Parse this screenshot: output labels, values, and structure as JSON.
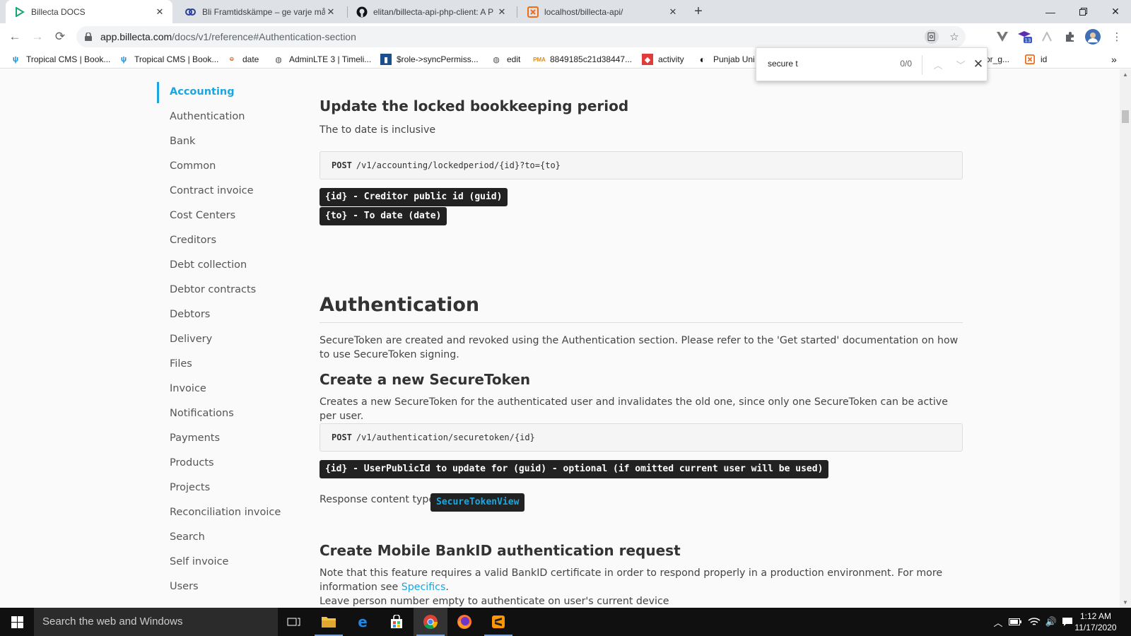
{
  "browser": {
    "tabs": [
      {
        "title": "Billecta DOCS",
        "icon": "billecta-icon"
      },
      {
        "title": "Bli Framtidskämpe – ge varje må",
        "icon": "framtid-icon"
      },
      {
        "title": "elitan/billecta-api-php-client: A P",
        "icon": "github-icon"
      },
      {
        "title": "localhost/billecta-api/",
        "icon": "localhost-icon"
      }
    ],
    "new_tab_label": "+",
    "url_host": "app.billecta.com",
    "url_path": "/docs/v1/reference#Authentication-section",
    "bookmarks": [
      {
        "label": "Tropical CMS | Book...",
        "icon": "palm-icon"
      },
      {
        "label": "Tropical CMS | Book...",
        "icon": "palm-icon"
      },
      {
        "label": "date",
        "icon": "php-icon"
      },
      {
        "label": "AdminLTE 3 | Timeli...",
        "icon": "globe-icon"
      },
      {
        "label": "$role->syncPermiss...",
        "icon": "bookmark-icon"
      },
      {
        "label": "edit",
        "icon": "globe-icon"
      },
      {
        "label": "8849185c21d38447...",
        "icon": "pma-icon"
      },
      {
        "label": "activity",
        "icon": "laravel-icon"
      },
      {
        "label": "Punjab Uni",
        "icon": "contrast-icon"
      },
      {
        "label": "or_g...",
        "icon": "bookmark-icon"
      },
      {
        "label": "id",
        "icon": "localhost-icon"
      }
    ],
    "profile_badge": "13",
    "find": {
      "query": "secure t",
      "count": "0/0"
    }
  },
  "sidebar": {
    "items": [
      {
        "label": "Accounting",
        "active": true
      },
      {
        "label": "Authentication"
      },
      {
        "label": "Bank"
      },
      {
        "label": "Common"
      },
      {
        "label": "Contract invoice"
      },
      {
        "label": "Cost Centers"
      },
      {
        "label": "Creditors"
      },
      {
        "label": "Debt collection"
      },
      {
        "label": "Debtor contracts"
      },
      {
        "label": "Debtors"
      },
      {
        "label": "Delivery"
      },
      {
        "label": "Files"
      },
      {
        "label": "Invoice"
      },
      {
        "label": "Notifications"
      },
      {
        "label": "Payments"
      },
      {
        "label": "Products"
      },
      {
        "label": "Projects"
      },
      {
        "label": "Reconciliation invoice"
      },
      {
        "label": "Search"
      },
      {
        "label": "Self invoice"
      },
      {
        "label": "Users"
      }
    ]
  },
  "content": {
    "locked_period": {
      "title": "Update the locked bookkeeping period",
      "desc": "The to date is inclusive",
      "method": "POST",
      "path": "/v1/accounting/lockedperiod/{id}?to={to}",
      "params": [
        "{id} - Creditor public id (guid)",
        "{to} - To date (date)"
      ]
    },
    "auth_section": {
      "title": "Authentication",
      "desc": "SecureToken are created and revoked using the Authentication section. Please refer to the 'Get started' documentation on how to use SecureToken signing."
    },
    "create_token": {
      "title": "Create a new SecureToken",
      "desc": "Creates a new SecureToken for the authenticated user and invalidates the old one, since only one SecureToken can be active per user.",
      "method": "POST",
      "path": "/v1/authentication/securetoken/{id}",
      "params": [
        "{id} - UserPublicId to update for (guid) - optional (if omitted current user will be used)"
      ],
      "response_label": "Response content type:",
      "response_type": "SecureTokenView"
    },
    "bankid": {
      "title": "Create Mobile BankID authentication request",
      "desc_before": "Note that this feature requires a valid BankID certificate in order to respond properly in a production environment. For more information see ",
      "desc_link": "Specifics",
      "desc_after": ".",
      "desc2": "Leave person number empty to authenticate on user's current device"
    }
  },
  "taskbar": {
    "search_placeholder": "Search the web and Windows",
    "time": "1:12 AM",
    "date": "11/17/2020"
  },
  "colors": {
    "accent": "#1aa7e0",
    "code_bg": "#222222",
    "tabstrip": "#dee1e6"
  }
}
